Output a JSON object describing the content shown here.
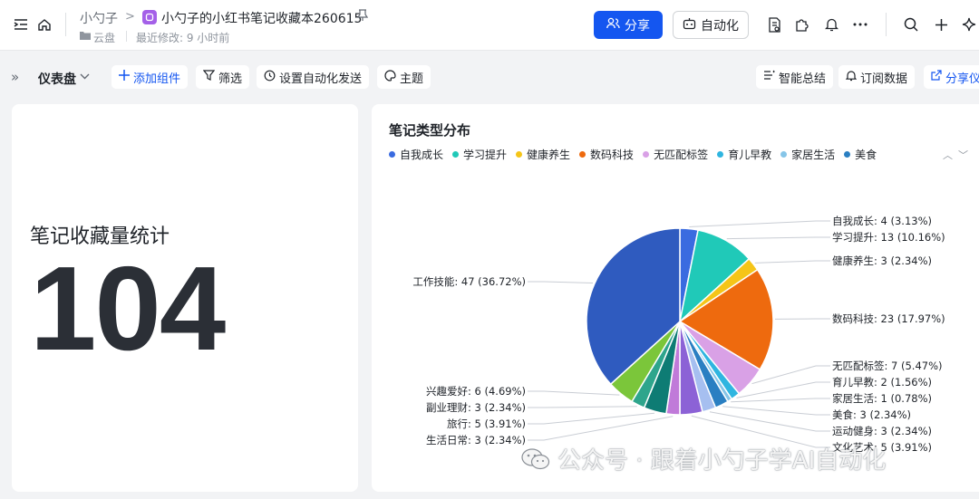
{
  "header": {
    "workspace": "小勺子",
    "doc_title": "小勺子的小红书笔记收藏本260615",
    "location": "云盘",
    "last_modified": "最近修改: 9 小时前",
    "share_label": "分享",
    "automation_label": "自动化"
  },
  "toolbar": {
    "dashboard_label": "仪表盘",
    "add_widget": "添加组件",
    "filter": "筛选",
    "auto_send": "设置自动化发送",
    "theme": "主题",
    "smart_summary": "智能总结",
    "subscribe": "订阅数据",
    "share_dashboard": "分享仪"
  },
  "stat_card": {
    "title": "笔记收藏量统计",
    "value": "104"
  },
  "watermark": "公众号 · 跟着小勺子学AI自动化",
  "chart_data": {
    "type": "pie",
    "title": "笔记类型分布",
    "legend_visible": [
      "自我成长",
      "学习提升",
      "健康养生",
      "数码科技",
      "无匹配标签",
      "育儿早教",
      "家居生活",
      "美食"
    ],
    "legend_placement": "top-left",
    "slices": [
      {
        "name": "自我成长",
        "value": 4,
        "pct": "3.13%",
        "color": "#3a6be0"
      },
      {
        "name": "学习提升",
        "value": 13,
        "pct": "10.16%",
        "color": "#20c9b8"
      },
      {
        "name": "健康养生",
        "value": 3,
        "pct": "2.34%",
        "color": "#f5c518"
      },
      {
        "name": "数码科技",
        "value": 23,
        "pct": "17.97%",
        "color": "#ee6a0e"
      },
      {
        "name": "无匹配标签",
        "value": 7,
        "pct": "5.47%",
        "color": "#d9a1e6"
      },
      {
        "name": "育儿早教",
        "value": 2,
        "pct": "1.56%",
        "color": "#2fb5e0"
      },
      {
        "name": "家居生活",
        "value": 1,
        "pct": "0.78%",
        "color": "#86c5e8"
      },
      {
        "name": "美食",
        "value": 3,
        "pct": "2.34%",
        "color": "#2a7fc2"
      },
      {
        "name": "运动健身",
        "value": 3,
        "pct": "2.34%",
        "color": "#a6bff0"
      },
      {
        "name": "文化艺术",
        "value": 5,
        "pct": "3.91%",
        "color": "#8c62d6"
      },
      {
        "name": "生活日常",
        "value": 3,
        "pct": "2.34%",
        "color": "#c07ad9"
      },
      {
        "name": "旅行",
        "value": 5,
        "pct": "3.91%",
        "color": "#0e7c74"
      },
      {
        "name": "副业理财",
        "value": 3,
        "pct": "2.34%",
        "color": "#2ea58c"
      },
      {
        "name": "兴趣爱好",
        "value": 6,
        "pct": "4.69%",
        "color": "#7bc63a"
      },
      {
        "name": "工作技能",
        "value": 47,
        "pct": "36.72%",
        "color": "#2f5bbf"
      }
    ]
  }
}
